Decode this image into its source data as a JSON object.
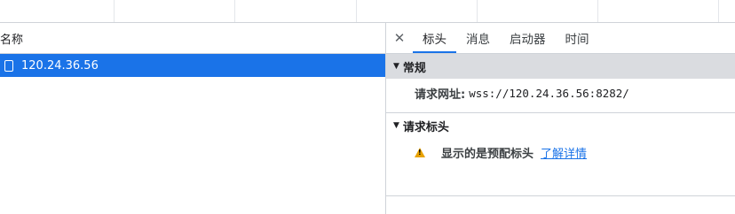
{
  "request_list": {
    "header": "名称",
    "rows": [
      {
        "name": "120.24.36.56",
        "icon": "document-icon",
        "selected": true
      }
    ]
  },
  "details": {
    "close_label": "✕",
    "tabs": [
      {
        "label": "标头",
        "active": true
      },
      {
        "label": "消息",
        "active": false
      },
      {
        "label": "启动器",
        "active": false
      },
      {
        "label": "时间",
        "active": false
      }
    ],
    "general": {
      "title": "常规",
      "request_url_label": "请求网址:",
      "request_url_value": "wss://120.24.36.56:8282/"
    },
    "request_headers": {
      "title": "请求标头",
      "warning_icon": "warning-icon",
      "warning_text": "显示的是预配标头",
      "learn_more": "了解详情"
    }
  },
  "colors": {
    "selection": "#1a73e8",
    "section_bg": "#dadce0",
    "warning": "#e8a200",
    "link": "#1a73e8"
  }
}
